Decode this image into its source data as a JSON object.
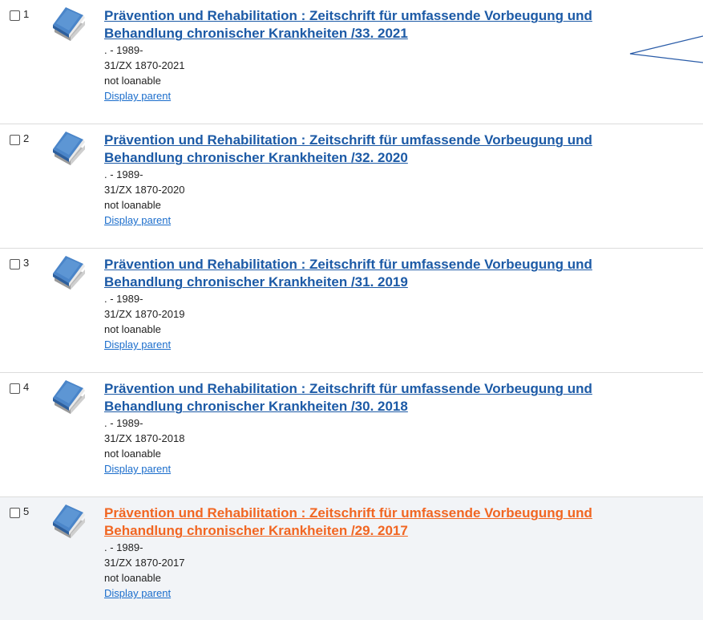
{
  "results": [
    {
      "number": "1",
      "title_line1": "Prävention und Rehabilitation : Zeitschrift für umfassende Vorbeugung und",
      "title_line2": "Behandlung chronischer Krankheiten /33. 2021",
      "years": ". - 1989-",
      "shelfmark": "31/ZX 1870-2021",
      "loan_status": "not loanable",
      "parent_link": "Display parent"
    },
    {
      "number": "2",
      "title_line1": "Prävention und Rehabilitation : Zeitschrift für umfassende Vorbeugung und",
      "title_line2": "Behandlung chronischer Krankheiten /32. 2020",
      "years": ". - 1989-",
      "shelfmark": "31/ZX 1870-2020",
      "loan_status": "not loanable",
      "parent_link": "Display parent"
    },
    {
      "number": "3",
      "title_line1": "Prävention und Rehabilitation : Zeitschrift für umfassende Vorbeugung und",
      "title_line2": "Behandlung chronischer Krankheiten /31. 2019",
      "years": ". - 1989-",
      "shelfmark": "31/ZX 1870-2019",
      "loan_status": "not loanable",
      "parent_link": "Display parent"
    },
    {
      "number": "4",
      "title_line1": "Prävention und Rehabilitation : Zeitschrift für umfassende Vorbeugung und",
      "title_line2": "Behandlung chronischer Krankheiten /30. 2018",
      "years": ". - 1989-",
      "shelfmark": "31/ZX 1870-2018",
      "loan_status": "not loanable",
      "parent_link": "Display parent"
    },
    {
      "number": "5",
      "title_line1": "Prävention und Rehabilitation : Zeitschrift für umfassende Vorbeugung und",
      "title_line2": "Behandlung chronischer Krankheiten /29. 2017",
      "years": ". - 1989-",
      "shelfmark": "31/ZX 1870-2017",
      "loan_status": "not loanable",
      "parent_link": "Display parent"
    }
  ],
  "colors": {
    "title_link": "#1c5aa6",
    "title_link_hover": "#f16622",
    "parent_link": "#1c6ecc",
    "hover_background": "#f2f4f7"
  },
  "icons": {
    "record_type": "book-icon",
    "checkbox": "checkbox-icon"
  }
}
